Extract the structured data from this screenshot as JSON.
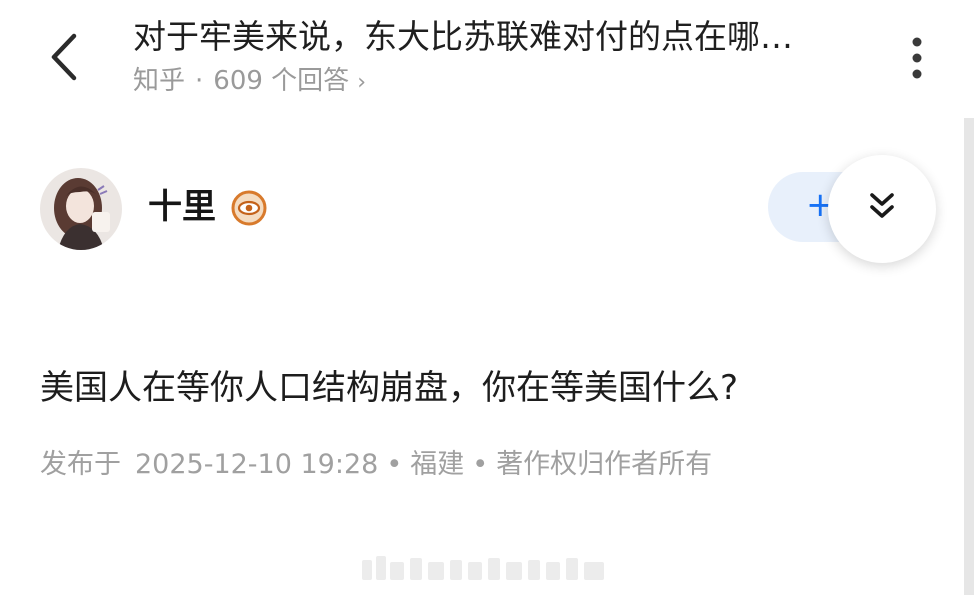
{
  "header": {
    "title": "对于牢美来说，东大比苏联难对付的点在哪…",
    "source": "知乎",
    "separator": "·",
    "answer_count": "609 个回答",
    "answer_chevron": "›"
  },
  "author": {
    "name": "十里",
    "follow_label": "+"
  },
  "answer": {
    "text": "美国人在等你人口结构崩盘，你在等美国什么?",
    "meta_prefix": "发布于",
    "meta_date": "2025-12-10  19:28",
    "meta_location": "福建",
    "meta_copyright": "著作权归作者所有",
    "meta_dot": "•"
  },
  "icons": {
    "back": "chevron-left-icon",
    "more": "more-vertical-icon",
    "badge": "eye-badge-icon",
    "expand": "double-chevron-down-icon"
  },
  "colors": {
    "accent": "#1772f6",
    "follow_bg": "#e8f0fb",
    "badge": "#d87a2c",
    "muted_text": "#a0a0a0"
  }
}
